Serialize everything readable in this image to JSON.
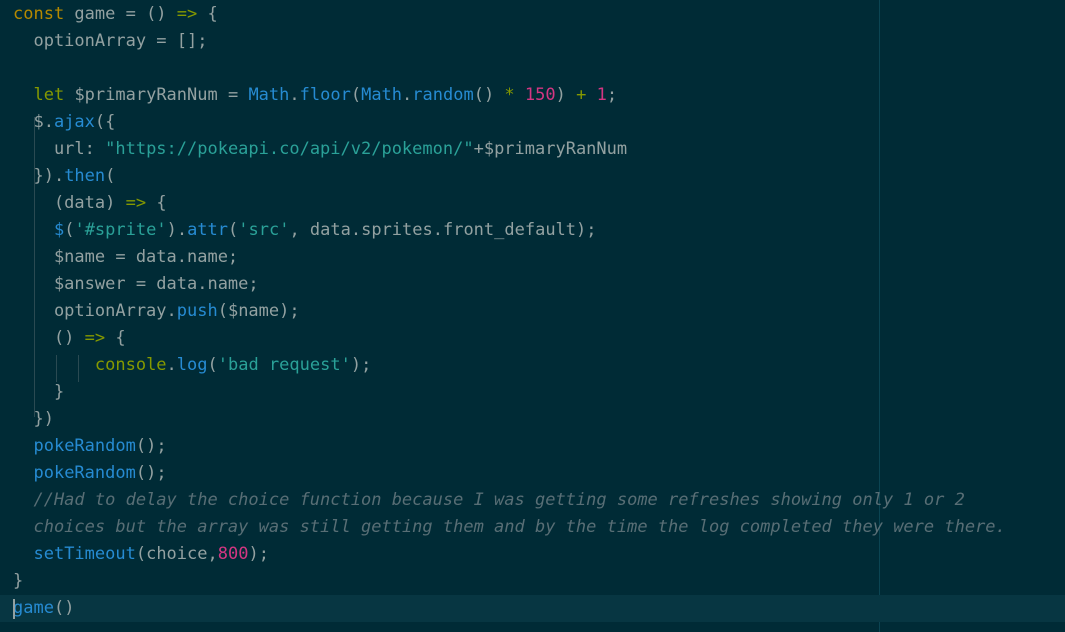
{
  "editor": {
    "lines": [
      {
        "tokens": [
          {
            "t": "const",
            "c": "kw-const"
          },
          {
            "t": " game = () ",
            "c": "tx"
          },
          {
            "t": "=>",
            "c": "op"
          },
          {
            "t": " {",
            "c": "tx"
          }
        ]
      },
      {
        "tokens": [
          {
            "t": "  optionArray = [];",
            "c": "tx"
          }
        ]
      },
      {
        "tokens": []
      },
      {
        "tokens": [
          {
            "t": "  ",
            "c": "tx"
          },
          {
            "t": "let",
            "c": "kw-let"
          },
          {
            "t": " $primaryRanNum = ",
            "c": "tx"
          },
          {
            "t": "Math",
            "c": "fn"
          },
          {
            "t": ".",
            "c": "tx"
          },
          {
            "t": "floor",
            "c": "fn"
          },
          {
            "t": "(",
            "c": "tx"
          },
          {
            "t": "Math",
            "c": "fn"
          },
          {
            "t": ".",
            "c": "tx"
          },
          {
            "t": "random",
            "c": "fn"
          },
          {
            "t": "() ",
            "c": "tx"
          },
          {
            "t": "*",
            "c": "op"
          },
          {
            "t": " ",
            "c": "tx"
          },
          {
            "t": "150",
            "c": "num"
          },
          {
            "t": ") ",
            "c": "tx"
          },
          {
            "t": "+",
            "c": "op"
          },
          {
            "t": " ",
            "c": "tx"
          },
          {
            "t": "1",
            "c": "num"
          },
          {
            "t": ";",
            "c": "tx"
          }
        ]
      },
      {
        "tokens": [
          {
            "t": "  $.",
            "c": "tx"
          },
          {
            "t": "ajax",
            "c": "fn"
          },
          {
            "t": "({",
            "c": "tx"
          }
        ]
      },
      {
        "tokens": [
          {
            "t": "    url: ",
            "c": "tx"
          },
          {
            "t": "\"https://pokeapi.co/api/v2/pokemon/\"",
            "c": "str"
          },
          {
            "t": "+$primaryRanNum",
            "c": "tx"
          }
        ]
      },
      {
        "tokens": [
          {
            "t": "  }).",
            "c": "tx"
          },
          {
            "t": "then",
            "c": "fn"
          },
          {
            "t": "(",
            "c": "tx"
          }
        ]
      },
      {
        "tokens": [
          {
            "t": "    (data) ",
            "c": "tx"
          },
          {
            "t": "=>",
            "c": "op"
          },
          {
            "t": " {",
            "c": "tx"
          }
        ]
      },
      {
        "tokens": [
          {
            "t": "    ",
            "c": "tx"
          },
          {
            "t": "$",
            "c": "fn"
          },
          {
            "t": "(",
            "c": "tx"
          },
          {
            "t": "'#sprite'",
            "c": "str"
          },
          {
            "t": ").",
            "c": "tx"
          },
          {
            "t": "attr",
            "c": "fn"
          },
          {
            "t": "(",
            "c": "tx"
          },
          {
            "t": "'src'",
            "c": "str"
          },
          {
            "t": ", data.sprites.front_default);",
            "c": "tx"
          }
        ]
      },
      {
        "tokens": [
          {
            "t": "    $name = data.name;",
            "c": "tx"
          }
        ]
      },
      {
        "tokens": [
          {
            "t": "    $answer = data.name;",
            "c": "tx"
          }
        ]
      },
      {
        "tokens": [
          {
            "t": "    optionArray.",
            "c": "tx"
          },
          {
            "t": "push",
            "c": "fn"
          },
          {
            "t": "($name);",
            "c": "tx"
          }
        ]
      },
      {
        "tokens": [
          {
            "t": "    () ",
            "c": "tx"
          },
          {
            "t": "=>",
            "c": "op"
          },
          {
            "t": " {",
            "c": "tx"
          }
        ]
      },
      {
        "tokens": [
          {
            "t": "        ",
            "c": "tx"
          },
          {
            "t": "console",
            "c": "kw"
          },
          {
            "t": ".",
            "c": "tx"
          },
          {
            "t": "log",
            "c": "fn"
          },
          {
            "t": "(",
            "c": "tx"
          },
          {
            "t": "'bad request'",
            "c": "str"
          },
          {
            "t": ");",
            "c": "tx"
          }
        ]
      },
      {
        "tokens": [
          {
            "t": "    }",
            "c": "tx"
          }
        ]
      },
      {
        "tokens": [
          {
            "t": "  })",
            "c": "tx"
          }
        ]
      },
      {
        "tokens": [
          {
            "t": "  ",
            "c": "tx"
          },
          {
            "t": "pokeRandom",
            "c": "fn"
          },
          {
            "t": "();",
            "c": "tx"
          }
        ]
      },
      {
        "tokens": [
          {
            "t": "  ",
            "c": "tx"
          },
          {
            "t": "pokeRandom",
            "c": "fn"
          },
          {
            "t": "();",
            "c": "tx"
          }
        ]
      },
      {
        "tokens": [
          {
            "t": "  //Had to delay the choice function because I was getting some refreshes showing only 1 or 2",
            "c": "cm"
          }
        ]
      },
      {
        "tokens": [
          {
            "t": "  choices but the array was still getting them and by the time the log completed they were there.",
            "c": "cm"
          }
        ]
      },
      {
        "tokens": [
          {
            "t": "  ",
            "c": "tx"
          },
          {
            "t": "setTimeout",
            "c": "fn"
          },
          {
            "t": "(choice,",
            "c": "tx"
          },
          {
            "t": "800",
            "c": "num"
          },
          {
            "t": ");",
            "c": "tx"
          }
        ]
      },
      {
        "tokens": [
          {
            "t": "}",
            "c": "tx"
          }
        ]
      },
      {
        "tokens": [
          {
            "t": "game",
            "c": "fn"
          },
          {
            "t": "()",
            "c": "tx"
          }
        ]
      }
    ],
    "current_line": 22
  }
}
